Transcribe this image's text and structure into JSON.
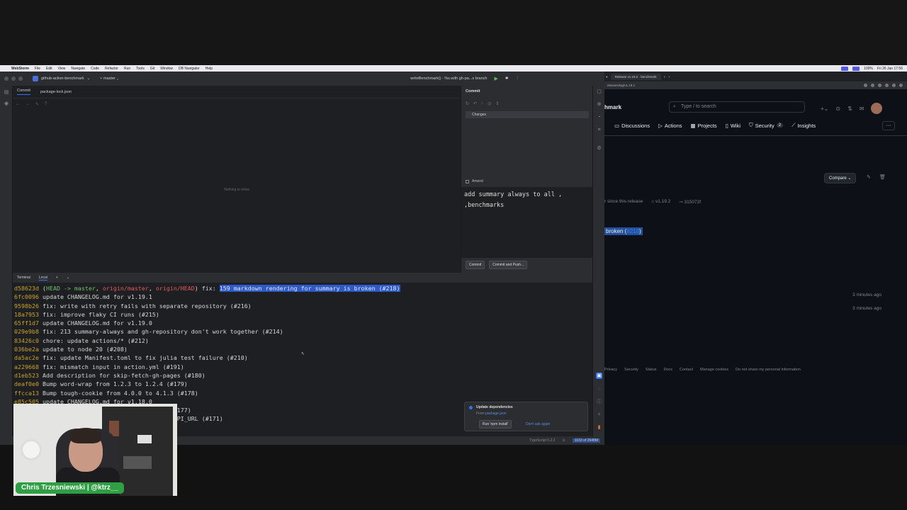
{
  "mac_menubar": {
    "app": "WebStorm",
    "items": [
      "File",
      "Edit",
      "View",
      "Navigate",
      "Code",
      "Refactor",
      "Run",
      "Tools",
      "Git",
      "Window",
      "DB Navigator",
      "Help"
    ],
    "clock": "Fri 26 Jan 17:56",
    "battery": "100%"
  },
  "ide": {
    "project": "github-action-benchmark",
    "branch": "master",
    "run_config": "writeBenchmark() - %s.with gh-pa...s branch",
    "tabs": [
      "Commit",
      "package-lock.json"
    ],
    "editor_empty": "Nothing to show",
    "commit_panel": {
      "title": "Commit",
      "changes_label": "Changes",
      "amend_label": "Amend",
      "message": "add summary always to all ,\n,benchmarks",
      "commit_button": "Commit",
      "commit_push_button": "Commit and Push..."
    },
    "terminal": {
      "tab_title": "Terminal",
      "tab_local": "Local",
      "lines": [
        {
          "hash": "d58623d",
          "refs_open": "(",
          "ref_head": "HEAD -> master",
          "ref_sep1": ", ",
          "ref_origin_master": "origin/master",
          "ref_sep2": ", ",
          "ref_origin_head": "origin/HEAD",
          "refs_close": ")",
          "pre": " fix: ",
          "highlight": "159 markdown rendering for summary is broken (#218)"
        },
        {
          "hash": "6fc0096",
          "msg": "update CHANGELOG.md for v1.19.1"
        },
        {
          "hash": "9598b26",
          "msg": "fix: write with retry fails with separate repository (#216)"
        },
        {
          "hash": "18a7953",
          "msg": "fix: improve flaky CI runs (#215)"
        },
        {
          "hash": "65ff1d7",
          "msg": "update CHANGELOG.md for v1.19.0"
        },
        {
          "hash": "029e9b8",
          "msg": "fix: 213 summary-always and gh-repository don't work together (#214)"
        },
        {
          "hash": "83426c0",
          "msg": "chore: update actions/* (#212)"
        },
        {
          "hash": "036be2a",
          "msg": "update to node 20 (#208)"
        },
        {
          "hash": "da5ac2e",
          "msg": "fix: update Manifest.toml to fix julia test failure (#210)"
        },
        {
          "hash": "a229668",
          "msg": "fix: mismatch input in action.yml (#191)"
        },
        {
          "hash": "d1eb523",
          "msg": "Add description for skip-fetch-gh-pages (#180)"
        },
        {
          "hash": "deaf0e0",
          "msg": "Bump word-wrap from 1.2.3 to 1.2.4 (#179)"
        },
        {
          "hash": "ffcca13",
          "msg": "Bump tough-cookie from 4.0.0 to 4.1.3 (#178)"
        },
        {
          "hash": "e85c505",
          "msg": "update CHANGELOG.md for v1.18.0"
        },
        {
          "hash": "",
          "msg": "                          golang benchmarks (#177)"
        },
        {
          "hash": "",
          "msg": "                          to refer to GITHUB_API_URL (#171)"
        }
      ]
    },
    "status": {
      "typescript": "TypeScript 5.2.2",
      "memory": "1033 of 2048M"
    },
    "notification": {
      "title": "Update dependencies",
      "from_label": "From",
      "from_file": "package.json",
      "run_button": "Run 'npm install'",
      "dont_ask": "Don't ask again"
    }
  },
  "browser": {
    "tab_title": "Release v1.19.2 · benchmark",
    "url": "eleases/tag/v1.19.2",
    "repo_name": "hmark",
    "search_placeholder": "Type / to search",
    "nav": [
      {
        "label": "Discussions",
        "icon": "comment-icon"
      },
      {
        "label": "Actions",
        "icon": "play-icon"
      },
      {
        "label": "Projects",
        "icon": "table-icon"
      },
      {
        "label": "Wiki",
        "icon": "book-icon"
      },
      {
        "label": "Security",
        "icon": "shield-icon",
        "count": "2"
      },
      {
        "label": "Insights",
        "icon": "graph-icon"
      }
    ],
    "more": "···",
    "compare_label": "Compare",
    "meta_since": "r since this release",
    "meta_tag": "v1.19.2",
    "meta_commit": "315072f",
    "broken_text": "broken (",
    "broken_link": "#218",
    "broken_close": ")",
    "ago_1": "3 minutes ago",
    "ago_2": "3 minutes ago",
    "footer": [
      "Privacy",
      "Security",
      "Status",
      "Docs",
      "Contact",
      "Manage cookies",
      "Do not share my personal information"
    ]
  },
  "webcam": {
    "name_badge": "Chris Trzesniewski | @ktrz__"
  }
}
